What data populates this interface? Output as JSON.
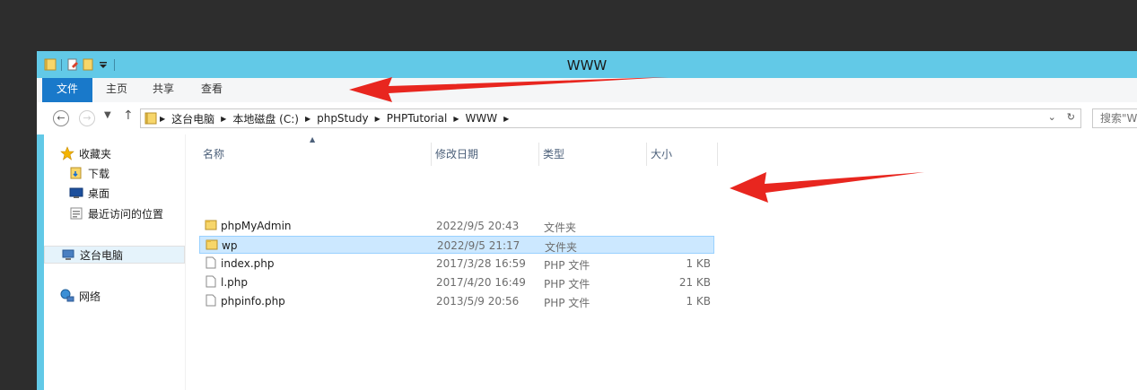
{
  "window": {
    "title": "WWW"
  },
  "ribbon": {
    "tabs": [
      {
        "label": "文件"
      },
      {
        "label": "主页"
      },
      {
        "label": "共享"
      },
      {
        "label": "查看"
      }
    ]
  },
  "address": {
    "crumbs": [
      "这台电脑",
      "本地磁盘 (C:)",
      "phpStudy",
      "PHPTutorial",
      "WWW"
    ]
  },
  "search": {
    "placeholder": "搜索\"WWW\""
  },
  "sidebar": {
    "favorites": "收藏夹",
    "items": [
      {
        "label": "下载"
      },
      {
        "label": "桌面"
      },
      {
        "label": "最近访问的位置"
      }
    ],
    "this_pc": "这台电脑",
    "network": "网络"
  },
  "columns": {
    "name": "名称",
    "date": "修改日期",
    "type": "类型",
    "size": "大小"
  },
  "files": [
    {
      "name": "phpMyAdmin",
      "date": "2022/9/5 20:43",
      "type": "文件夹",
      "size": "",
      "kind": "folder",
      "selected": false
    },
    {
      "name": "wp",
      "date": "2022/9/5 21:17",
      "type": "文件夹",
      "size": "",
      "kind": "folder",
      "selected": true
    },
    {
      "name": "index.php",
      "date": "2017/3/28 16:59",
      "type": "PHP 文件",
      "size": "1 KB",
      "kind": "file",
      "selected": false
    },
    {
      "name": "l.php",
      "date": "2017/4/20 16:49",
      "type": "PHP 文件",
      "size": "21 KB",
      "kind": "file",
      "selected": false
    },
    {
      "name": "phpinfo.php",
      "date": "2013/5/9 20:56",
      "type": "PHP 文件",
      "size": "1 KB",
      "kind": "file",
      "selected": false
    }
  ],
  "colors": {
    "titlebar": "#62c9e7",
    "file_tab": "#1979ca",
    "selection": "#cce8ff",
    "annotation_arrow": "#e8261f"
  }
}
